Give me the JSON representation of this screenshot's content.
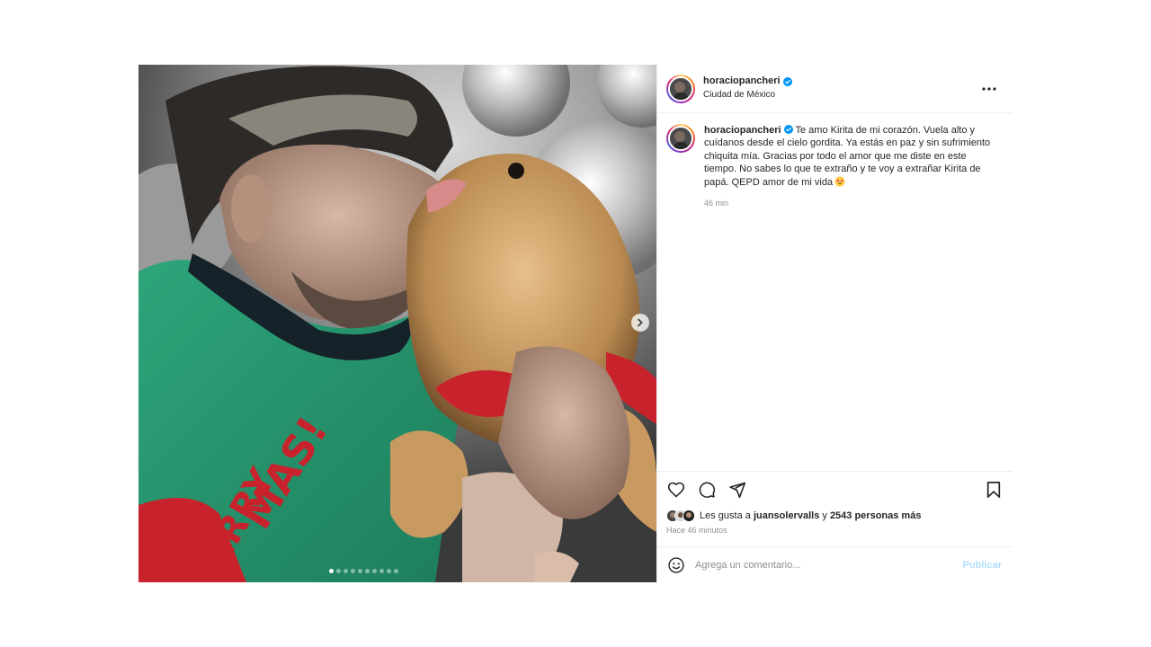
{
  "post": {
    "author": {
      "username": "horaciopancheri",
      "verified": true,
      "location": "Ciudad de México"
    },
    "caption": {
      "username": "horaciopancheri",
      "text": "Te amo Kirita de mi corazón. Vuela alto y cuídanos desde el cielo gordita. Ya estás en paz y sin sufrimiento chiquita mía. Gracias por todo el amor que me diste en este tiempo. No sabes lo que te extraño y te voy a extrañar Kirita de papá. QEPD amor de mi vida",
      "emoji": "smiling-face-with-heart-eyes-icon",
      "time_short": "46 min"
    },
    "carousel": {
      "slide_count": 10,
      "active_index": 0
    },
    "likes": {
      "prefix": "Les gusta a",
      "first_user": "juansolervalls",
      "joiner": "y",
      "others": "2543 personas más"
    },
    "time_long": "Hace 46 minutos",
    "comment_input": {
      "placeholder": "Agrega un comentario...",
      "value": ""
    },
    "publish_label": "Publicar"
  },
  "colors": {
    "verified_blue": "#0095f6",
    "publish_disabled": "#b2dffc",
    "muted_text": "#8e8e8e",
    "divider": "#efefef"
  }
}
